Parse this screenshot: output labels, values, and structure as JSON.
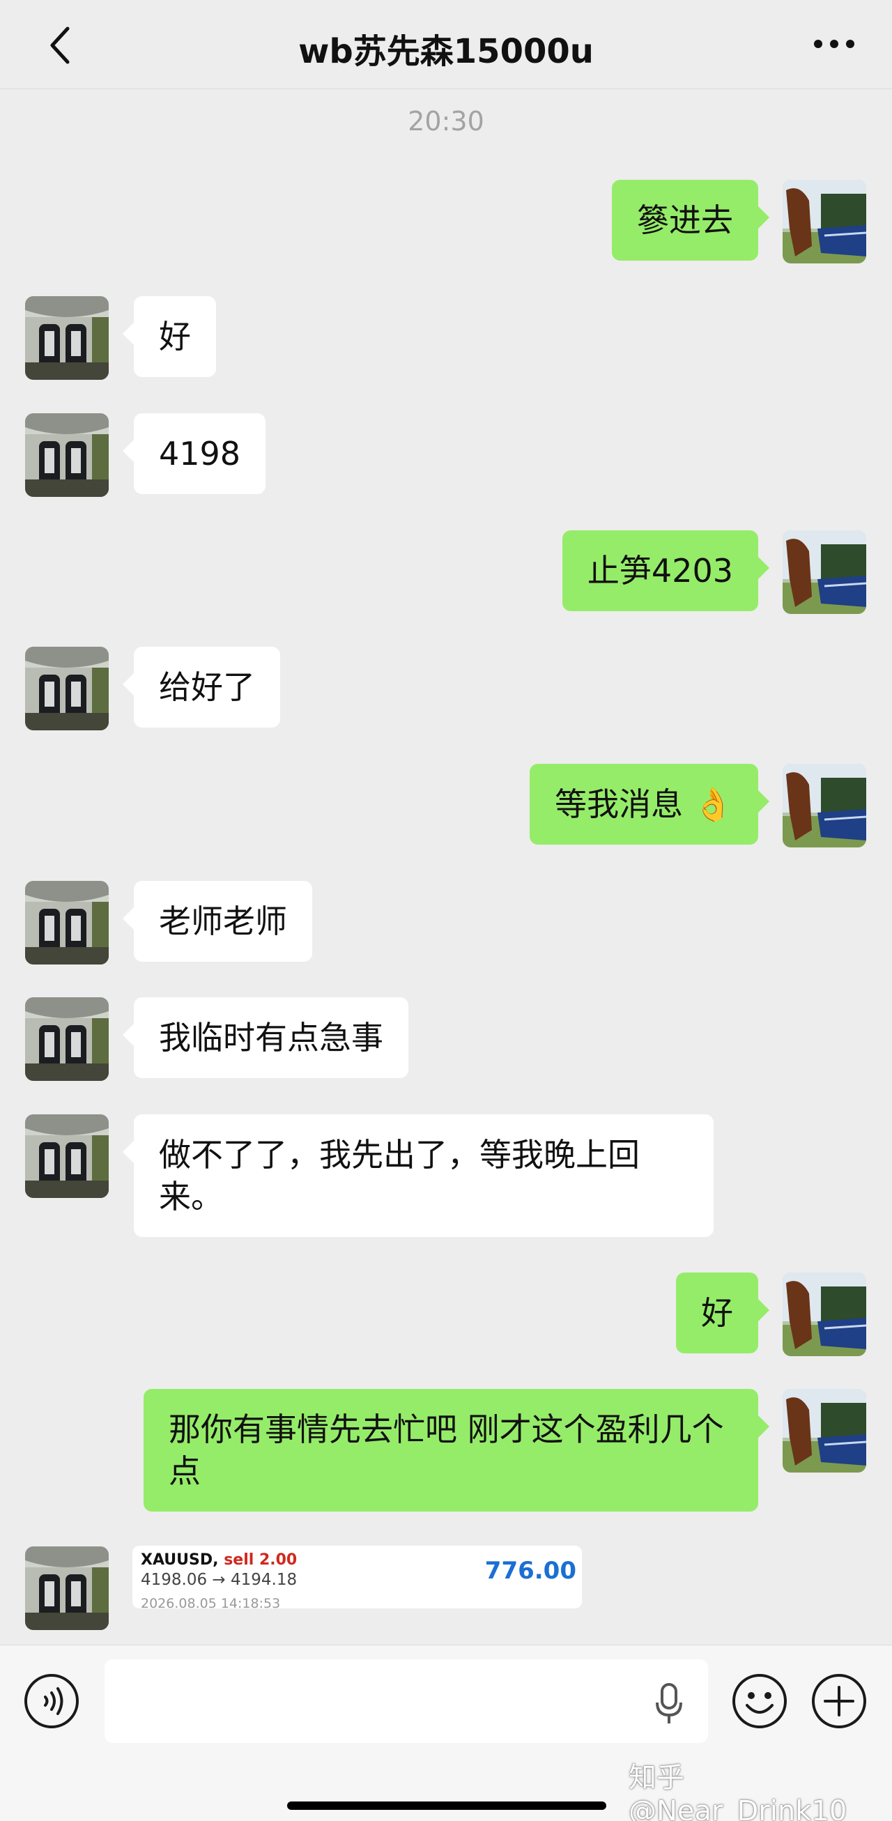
{
  "header": {
    "title": "wb苏先森15000u"
  },
  "timestamp": "20:30",
  "messages": [
    {
      "side": "out",
      "text": "篸进去"
    },
    {
      "side": "in",
      "text": "好"
    },
    {
      "side": "in",
      "text": "4198"
    },
    {
      "side": "out",
      "text": "止笋4203"
    },
    {
      "side": "in",
      "text": "给好了"
    },
    {
      "side": "out",
      "text": "等我消息 👌"
    },
    {
      "side": "in",
      "text": "老师老师"
    },
    {
      "side": "in",
      "text": "我临时有点急事"
    },
    {
      "side": "in",
      "text": "做不了了，我先出了，等我晚上回来。"
    },
    {
      "side": "out",
      "text": "好"
    },
    {
      "side": "out",
      "text": "那你有事情先去忙吧 刚才这个盈利几个点"
    }
  ],
  "trade_card": {
    "symbol": "XAUUSD,",
    "side": "sell 2.00",
    "prices": "4198.06 → 4194.18",
    "profit": "776.00",
    "datetime": "2026.08.05 14:18:53"
  },
  "watermark": "知乎 @Near_Drink10",
  "icons": {
    "back": "chevron-left-icon",
    "more": "more-dots-icon",
    "voice": "voice-icon",
    "mic": "microphone-icon",
    "emoji": "emoji-icon",
    "add": "add-icon"
  },
  "colors": {
    "background": "#ededed",
    "outgoing_bubble": "#95ec69",
    "incoming_bubble": "#ffffff",
    "profit": "#1a6fd3",
    "sell": "#d0281e"
  }
}
